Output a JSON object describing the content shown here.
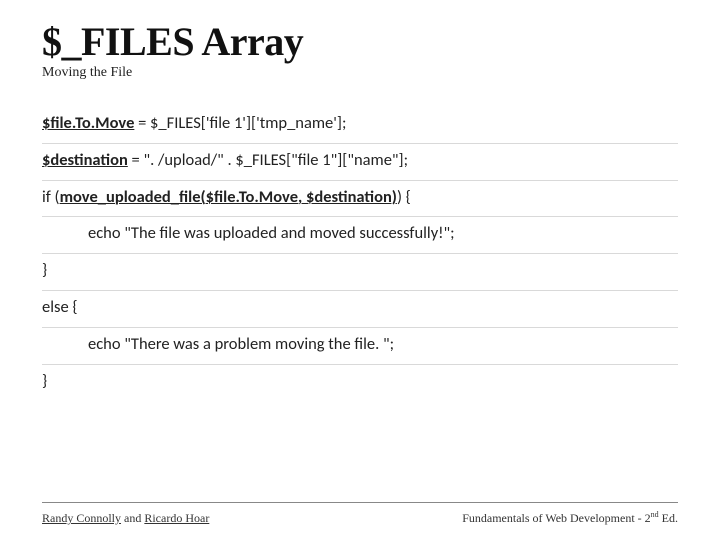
{
  "title": "$_FILES Array",
  "subtitle": "Moving the File",
  "code": {
    "l1": {
      "lhs": "$file.To.Move",
      "rhs": " = $_FILES['file 1']['tmp_name'];"
    },
    "l2": {
      "lhs": "$destination",
      "rhs": " = \". /upload/\" . $_FILES[\"file 1\"][\"name\"];"
    },
    "l3": {
      "pre": "if (",
      "fn": "move_uploaded_file($file.To.Move, $destination)",
      "post": ") {"
    },
    "l4": "echo \"The file was uploaded and moved successfully!\";",
    "l5": "}",
    "l6": "else {",
    "l7": "echo \"There was a problem moving the file. \";",
    "l8": "}"
  },
  "footer": {
    "left": {
      "name1": "Randy Connolly",
      "mid": " and ",
      "name2": "Ricardo Hoar"
    },
    "right": {
      "pre": "Fundamentals of Web Development - 2",
      "sup": "nd",
      "post": " Ed."
    }
  }
}
